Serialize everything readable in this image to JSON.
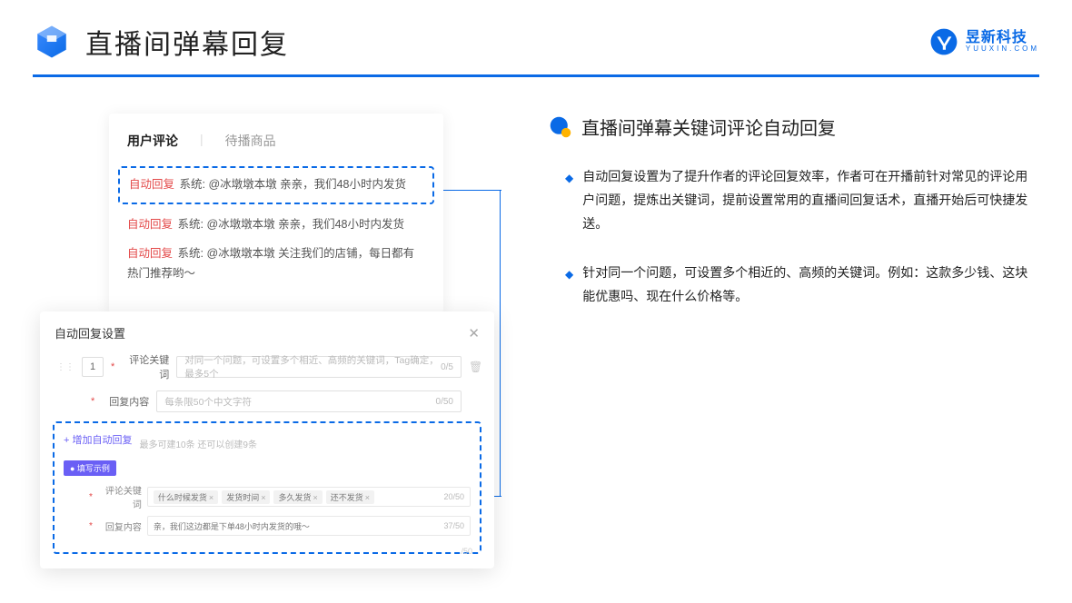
{
  "header": {
    "title": "直播间弹幕回复",
    "logo_cn": "昱新科技",
    "logo_en": "YUUXIN.COM"
  },
  "card1": {
    "tab_active": "用户评论",
    "tab_inactive": "待播商品",
    "msg1_tag": "自动回复",
    "msg1_text": "系统: @冰墩墩本墩 亲亲，我们48小时内发货",
    "msg2_tag": "自动回复",
    "msg2_text": "系统: @冰墩墩本墩 亲亲，我们48小时内发货",
    "msg3_tag": "自动回复",
    "msg3_text": "系统: @冰墩墩本墩 关注我们的店铺，每日都有热门推荐哟～"
  },
  "card2": {
    "title": "自动回复设置",
    "row_num": "1",
    "keyword_label": "评论关键词",
    "keyword_placeholder": "对同一个问题，可设置多个相近、高频的关键词，Tag确定，最多5个",
    "keyword_count": "0/5",
    "content_label": "回复内容",
    "content_placeholder": "每条限50个中文字符",
    "content_count": "0/50",
    "add_link": "+ 增加自动回复",
    "add_hint": "最多可建10条 还可以创建9条",
    "example_badge": "● 填写示例",
    "ex_keyword_label": "评论关键词",
    "ex_tag1": "什么时候发货",
    "ex_tag2": "发货时间",
    "ex_tag3": "多久发货",
    "ex_tag4": "还不发货",
    "ex_keyword_count": "20/50",
    "ex_content_label": "回复内容",
    "ex_content_value": "亲，我们这边都是下单48小时内发货的哦～",
    "ex_content_count": "37/50",
    "trailing": "/50"
  },
  "right": {
    "section_title": "直播间弹幕关键词评论自动回复",
    "bullet1": "自动回复设置为了提升作者的评论回复效率，作者可在开播前针对常见的评论用户问题，提炼出关键词，提前设置常用的直播间回复话术，直播开始后可快捷发送。",
    "bullet2": "针对同一个问题，可设置多个相近的、高频的关键词。例如：这款多少钱、这块能优惠吗、现在什么价格等。"
  }
}
